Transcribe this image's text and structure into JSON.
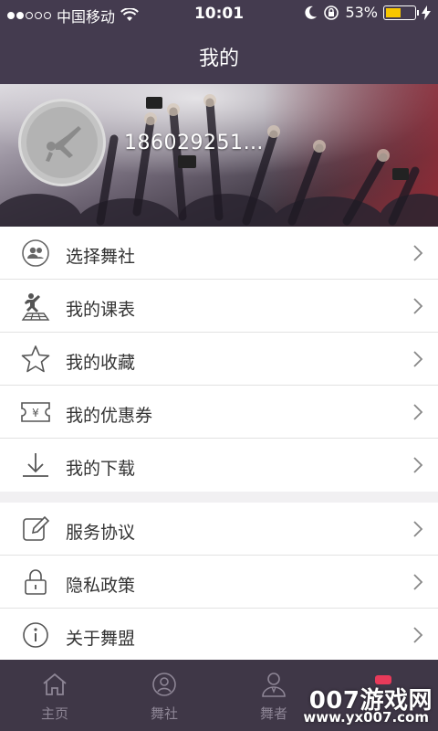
{
  "status_bar": {
    "carrier": "中国移动",
    "time": "10:01",
    "battery_percent": "53%",
    "battery_level": 0.53,
    "accent": "#f7c600"
  },
  "nav": {
    "title": "我的"
  },
  "profile": {
    "username": "186029251…"
  },
  "menu_group_1": [
    {
      "label": "选择舞社",
      "icon": "people-icon"
    },
    {
      "label": "我的课表",
      "icon": "dancer-icon"
    },
    {
      "label": "我的收藏",
      "icon": "star-icon"
    },
    {
      "label": "我的优惠券",
      "icon": "coupon-icon"
    },
    {
      "label": "我的下载",
      "icon": "download-icon"
    }
  ],
  "menu_group_2": [
    {
      "label": "服务协议",
      "icon": "edit-icon"
    },
    {
      "label": "隐私政策",
      "icon": "lock-icon"
    },
    {
      "label": "关于舞盟",
      "icon": "info-icon"
    }
  ],
  "tab_bar": {
    "tabs": [
      {
        "label": "主页",
        "icon": "home-icon"
      },
      {
        "label": "舞社",
        "icon": "club-icon"
      },
      {
        "label": "舞者",
        "icon": "dancer-person-icon"
      }
    ]
  },
  "watermark": {
    "text": "007游戏网",
    "url": "www.yx007.com"
  },
  "colors": {
    "header": "#443b4f",
    "tab_bar": "#3f3747",
    "background": "#f1f0f2"
  }
}
